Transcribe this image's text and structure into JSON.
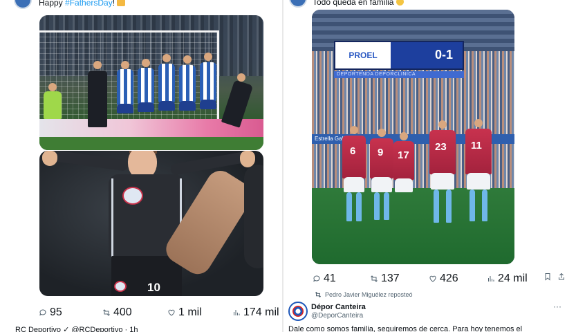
{
  "left_tweet": {
    "text_prefix": "Happy ",
    "hashtag": "#FathersDay",
    "text_suffix": "!",
    "emoji_icon": "gift-emoji",
    "actions": {
      "replies": "95",
      "reposts": "400",
      "likes": "1 mil",
      "views": "174 mil"
    }
  },
  "left_next_tweet": {
    "text": "RC Deportivo ✓ @RCDeportivo · 1h"
  },
  "right_tweet": {
    "header_text": "Todo queda en familia",
    "media": {
      "scoreboard_brand": "PROEL",
      "scoreboard_score": "0-1",
      "scoreboard_sub": "DEPORTENDA   DEPORCLINICA",
      "ad_line": "Estrella Galicia",
      "jersey_numbers": [
        "6",
        "9",
        "17",
        "23",
        "11"
      ]
    },
    "actions": {
      "replies": "41",
      "reposts": "137",
      "likes": "426",
      "views": "24 mil"
    }
  },
  "repost_notice": "Pedro Javier Miguélez reposteó",
  "next_tweet": {
    "author_name": "Dépor Canteira",
    "author_handle": "@DeporCanteira",
    "text": "Dale como somos familia, seguiremos de cerca. Para hoy tenemos el"
  },
  "colors": {
    "link": "#1d9bf0",
    "muted": "#536471",
    "text": "#0f1419"
  }
}
